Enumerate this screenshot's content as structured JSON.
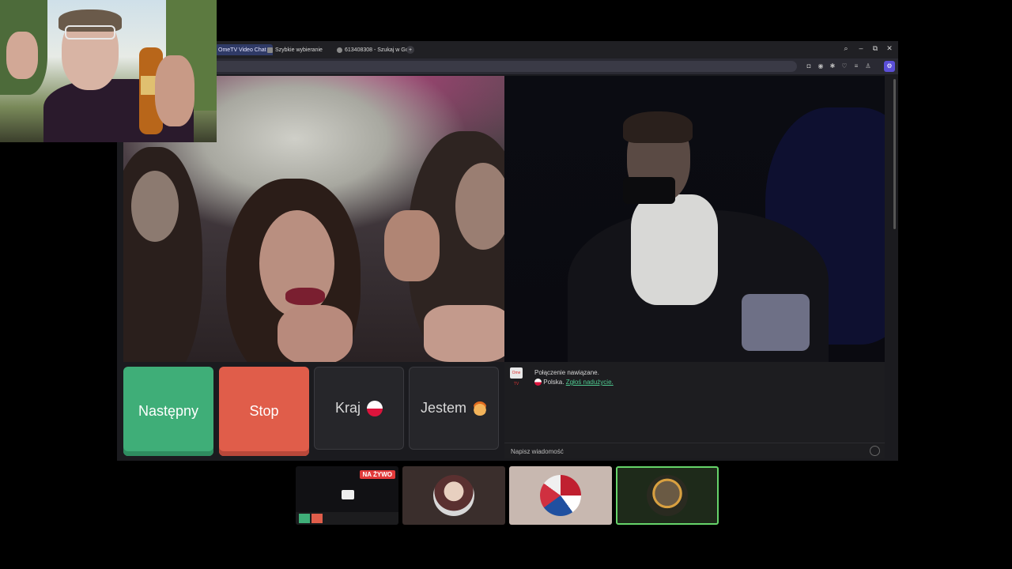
{
  "browser": {
    "tabs": [
      {
        "label": "OmeTV Video Chat -",
        "active": true
      },
      {
        "label": "Szybkie wybieranie",
        "active": false
      },
      {
        "label": "613408308 - Szukaj w Go",
        "active": false
      }
    ],
    "new_tab_label": "+",
    "window_controls": {
      "search": "⌕",
      "minimize": "–",
      "restore": "⧉",
      "close": "✕"
    }
  },
  "controls": {
    "next_label": "Następny",
    "stop_label": "Stop",
    "country_label": "Kraj",
    "gender_label": "Jestem"
  },
  "chat": {
    "logo_text": "Ome TV",
    "status_message": "Połączenie nawiązane.",
    "country": "Polska.",
    "report_link": "Zgłoś nadużycie.",
    "input_placeholder": "Napisz wiadomość"
  },
  "thumbnails": {
    "live_badge": "NA ŻYWO"
  },
  "colors": {
    "next_button": "#3fae78",
    "stop_button": "#e05d4a",
    "active_thumbnail_border": "#66d46a",
    "live_badge": "#e23a3a"
  }
}
